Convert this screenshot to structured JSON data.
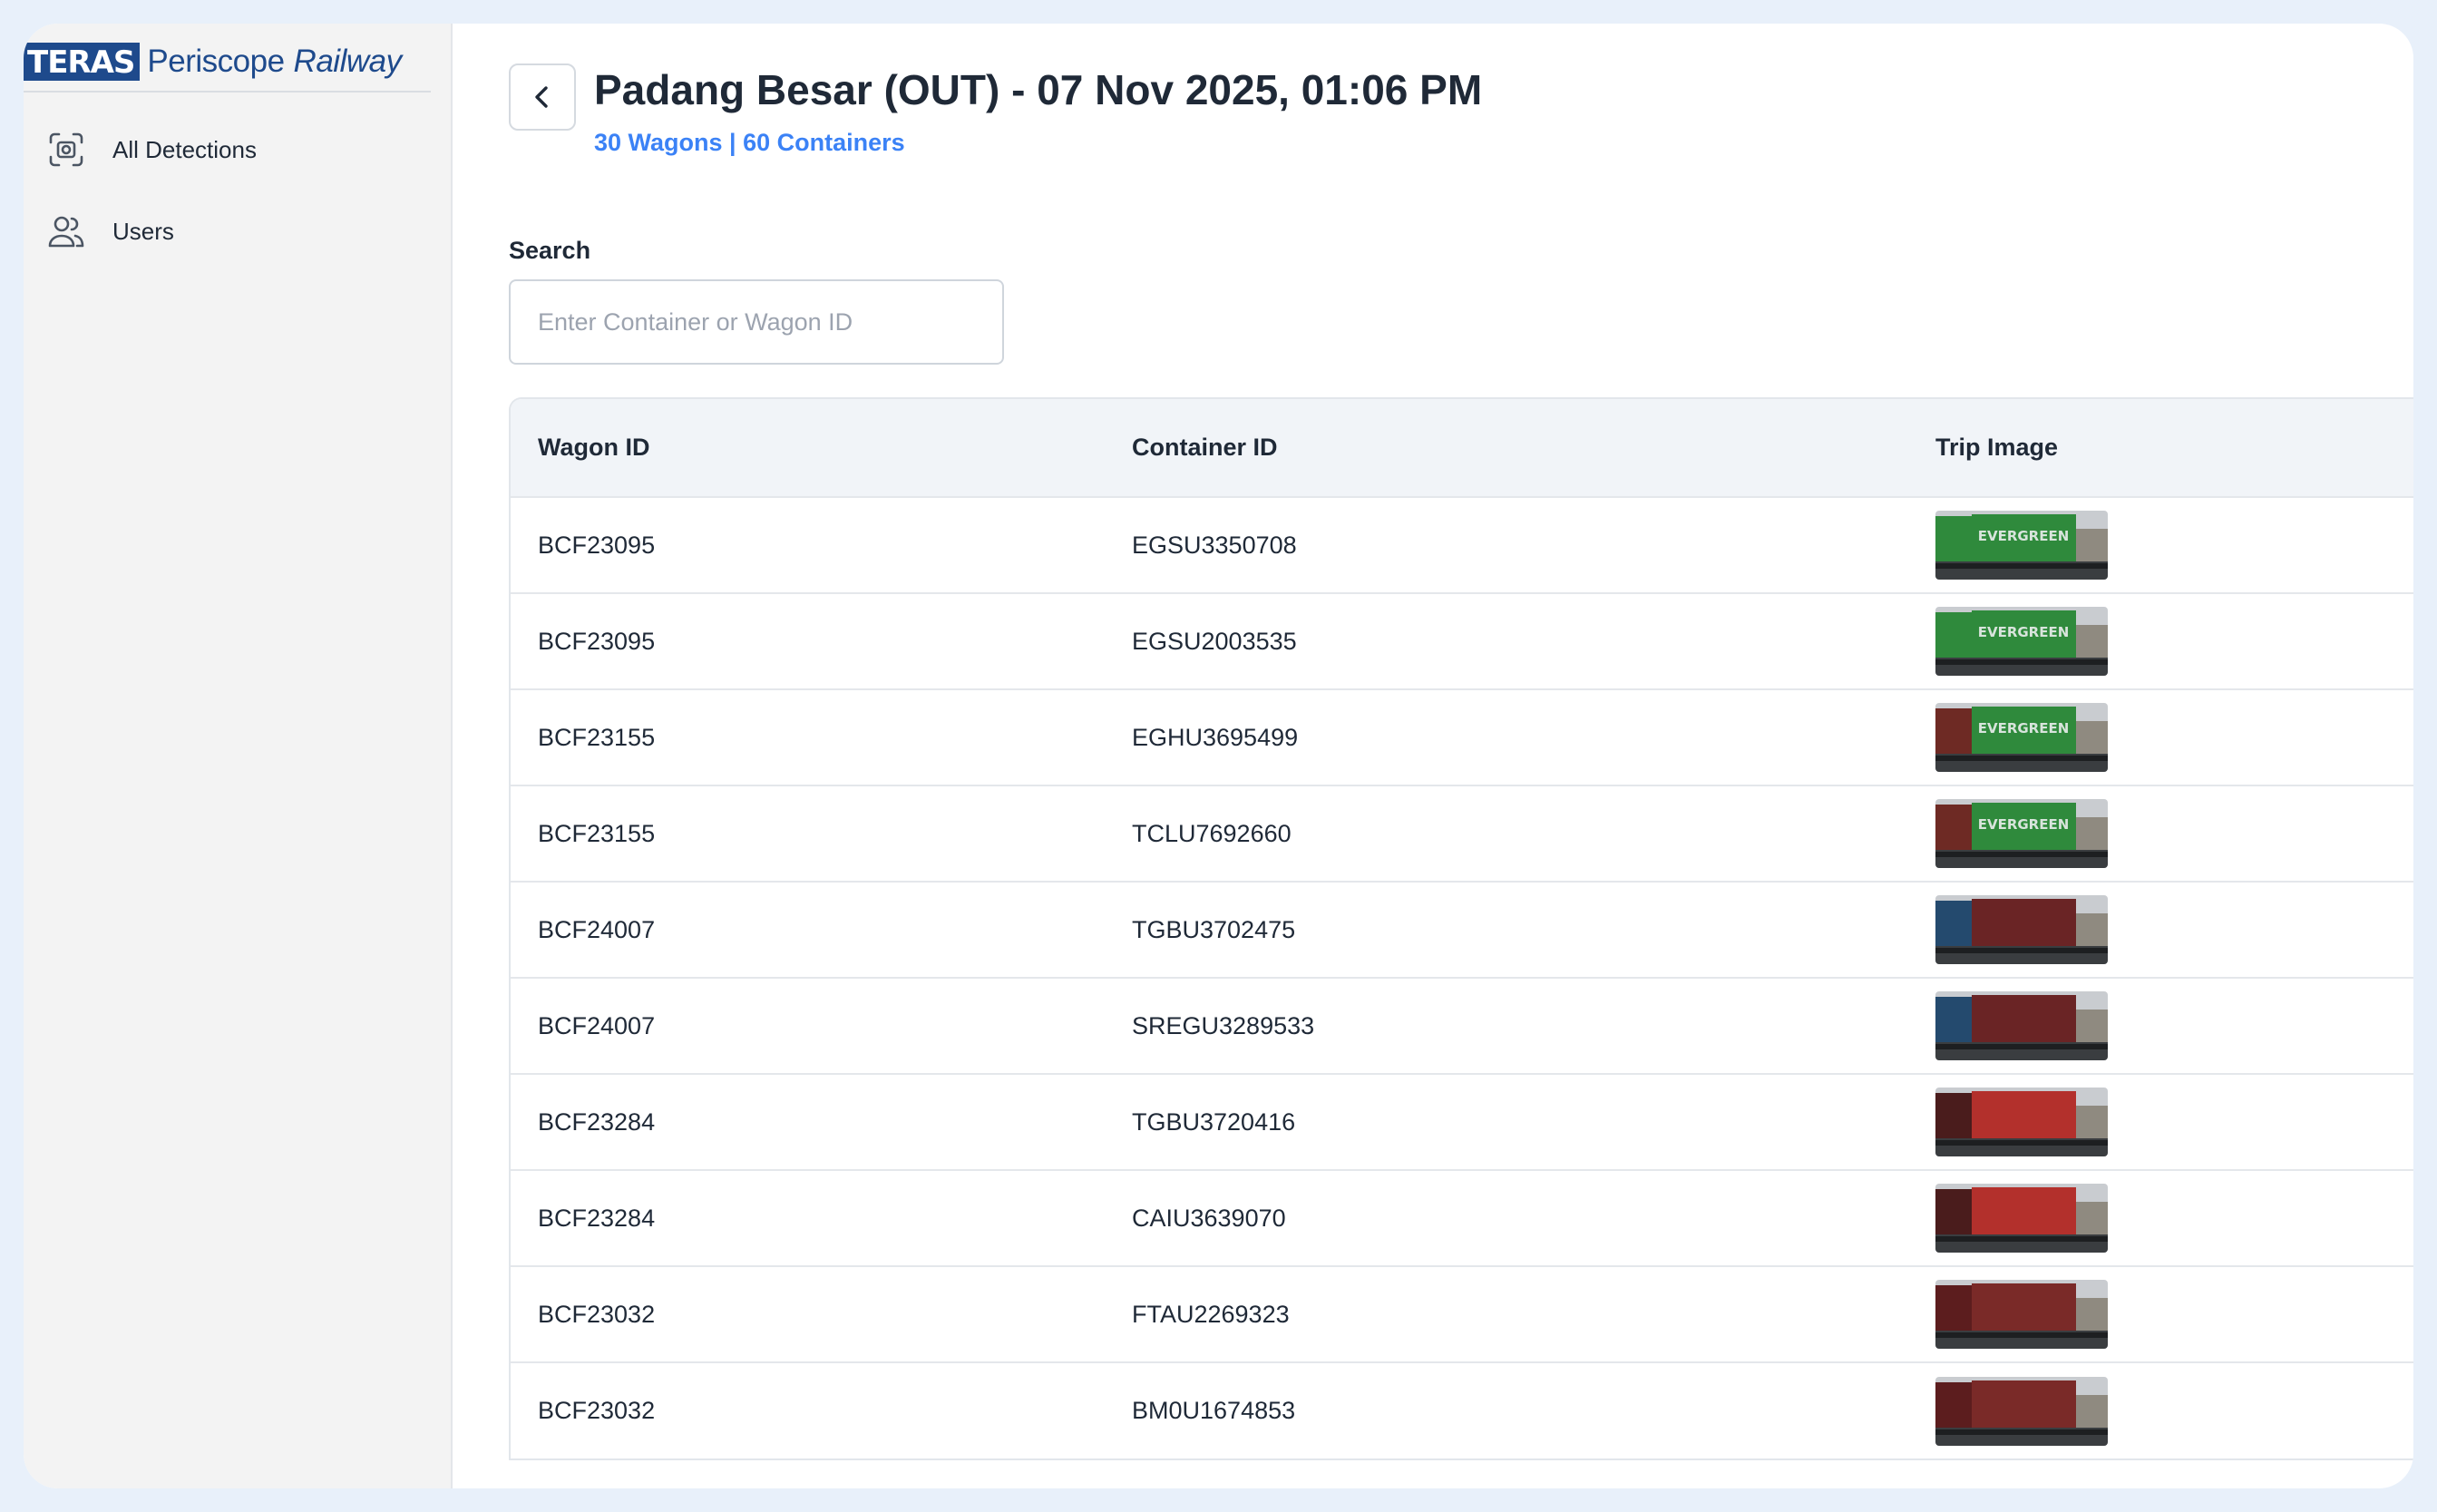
{
  "brand": {
    "mark": "TERAS",
    "name": "Periscope",
    "sub": "Railway"
  },
  "sidebar": {
    "items": [
      {
        "label": "All Detections",
        "icon": "scan-icon"
      },
      {
        "label": "Users",
        "icon": "users-icon"
      }
    ]
  },
  "header": {
    "title": "Padang Besar (OUT) - 07 Nov 2025, 01:06 PM",
    "subtitle": "30 Wagons | 60 Containers"
  },
  "search": {
    "label": "Search",
    "placeholder": "Enter Container or Wagon ID"
  },
  "table": {
    "columns": [
      "Wagon ID",
      "Container ID",
      "Trip Image"
    ],
    "rows": [
      {
        "wagon": "BCF23095",
        "container": "EGSU3350708",
        "thumb": "green",
        "text": "EVERGREEN"
      },
      {
        "wagon": "BCF23095",
        "container": "EGSU2003535",
        "thumb": "green",
        "text": "EVERGREEN"
      },
      {
        "wagon": "BCF23155",
        "container": "EGHU3695499",
        "thumb": "red-green",
        "text": "EVERGREEN"
      },
      {
        "wagon": "BCF23155",
        "container": "TCLU7692660",
        "thumb": "red-green",
        "text": "EVERGREEN"
      },
      {
        "wagon": "BCF24007",
        "container": "TGBU3702475",
        "thumb": "blue-maroon",
        "text": ""
      },
      {
        "wagon": "BCF24007",
        "container": "SREGU3289533",
        "thumb": "blue-maroon",
        "text": ""
      },
      {
        "wagon": "BCF23284",
        "container": "TGBU3720416",
        "thumb": "red",
        "text": ""
      },
      {
        "wagon": "BCF23284",
        "container": "CAIU3639070",
        "thumb": "red",
        "text": ""
      },
      {
        "wagon": "BCF23032",
        "container": "FTAU2269323",
        "thumb": "maroon",
        "text": ""
      },
      {
        "wagon": "BCF23032",
        "container": "BM0U1674853",
        "thumb": "maroon",
        "text": ""
      }
    ]
  },
  "colors": {
    "accent": "#3b82f6",
    "brand": "#1e4a8c"
  }
}
